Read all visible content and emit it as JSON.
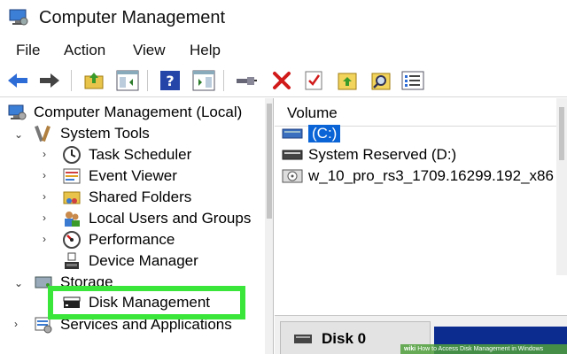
{
  "window": {
    "title": "Computer Management"
  },
  "menu": {
    "items": [
      "File",
      "Action",
      "View",
      "Help"
    ]
  },
  "toolbar": {
    "buttons": [
      "back-arrow-icon",
      "forward-arrow-icon",
      "up-folder-icon",
      "show-hide-tree-icon",
      "help-icon",
      "action-pane-icon",
      "connect-icon",
      "delete-icon",
      "properties-icon",
      "refresh-icon",
      "search-icon",
      "list-icon"
    ],
    "accent": "#2d6bd6",
    "delete_color": "#d11a1a"
  },
  "tree": {
    "root": "Computer Management (Local)",
    "system_tools": "System Tools",
    "task_scheduler": "Task Scheduler",
    "event_viewer": "Event Viewer",
    "shared_folders": "Shared Folders",
    "local_users": "Local Users and Groups",
    "performance": "Performance",
    "device_manager": "Device Manager",
    "storage": "Storage",
    "disk_management": "Disk Management",
    "services": "Services and Applications"
  },
  "highlight": {
    "color": "#39e639"
  },
  "volume_list": {
    "header": "Volume",
    "rows": [
      "(C:)",
      "System Reserved (D:)",
      "w_10_pro_rs3_1709.16299.192_x86"
    ],
    "selected_color": "#0a64d6"
  },
  "disk": {
    "label": "Disk 0",
    "bar_color": "#0c2c8f"
  },
  "watermark": {
    "prefix": "wiki",
    "text": "How to Access Disk Management in Windows"
  }
}
